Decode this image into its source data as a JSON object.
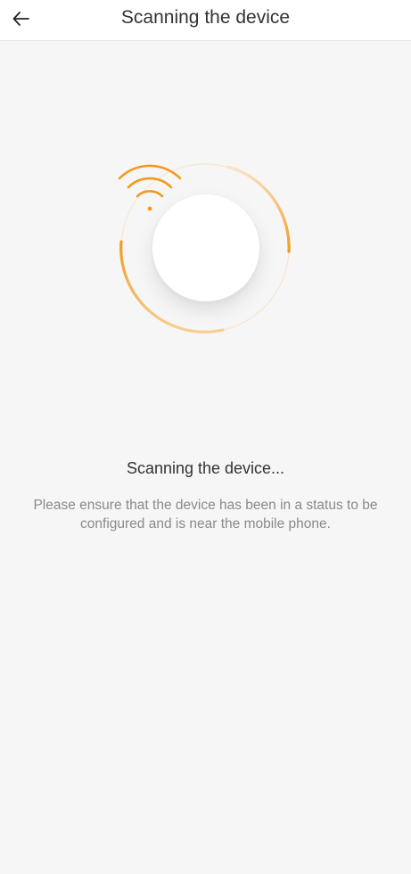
{
  "header": {
    "title": "Scanning the device",
    "back_icon": "arrow-left-icon"
  },
  "scan": {
    "icon": "wifi-icon",
    "accent_color": "#f39a1e",
    "ring_color": "#f8dfb9"
  },
  "status": {
    "title": "Scanning the device...",
    "description_line1": "Please ensure that the device has been in a status to be",
    "description_line2": "configured and is near the mobile phone."
  }
}
